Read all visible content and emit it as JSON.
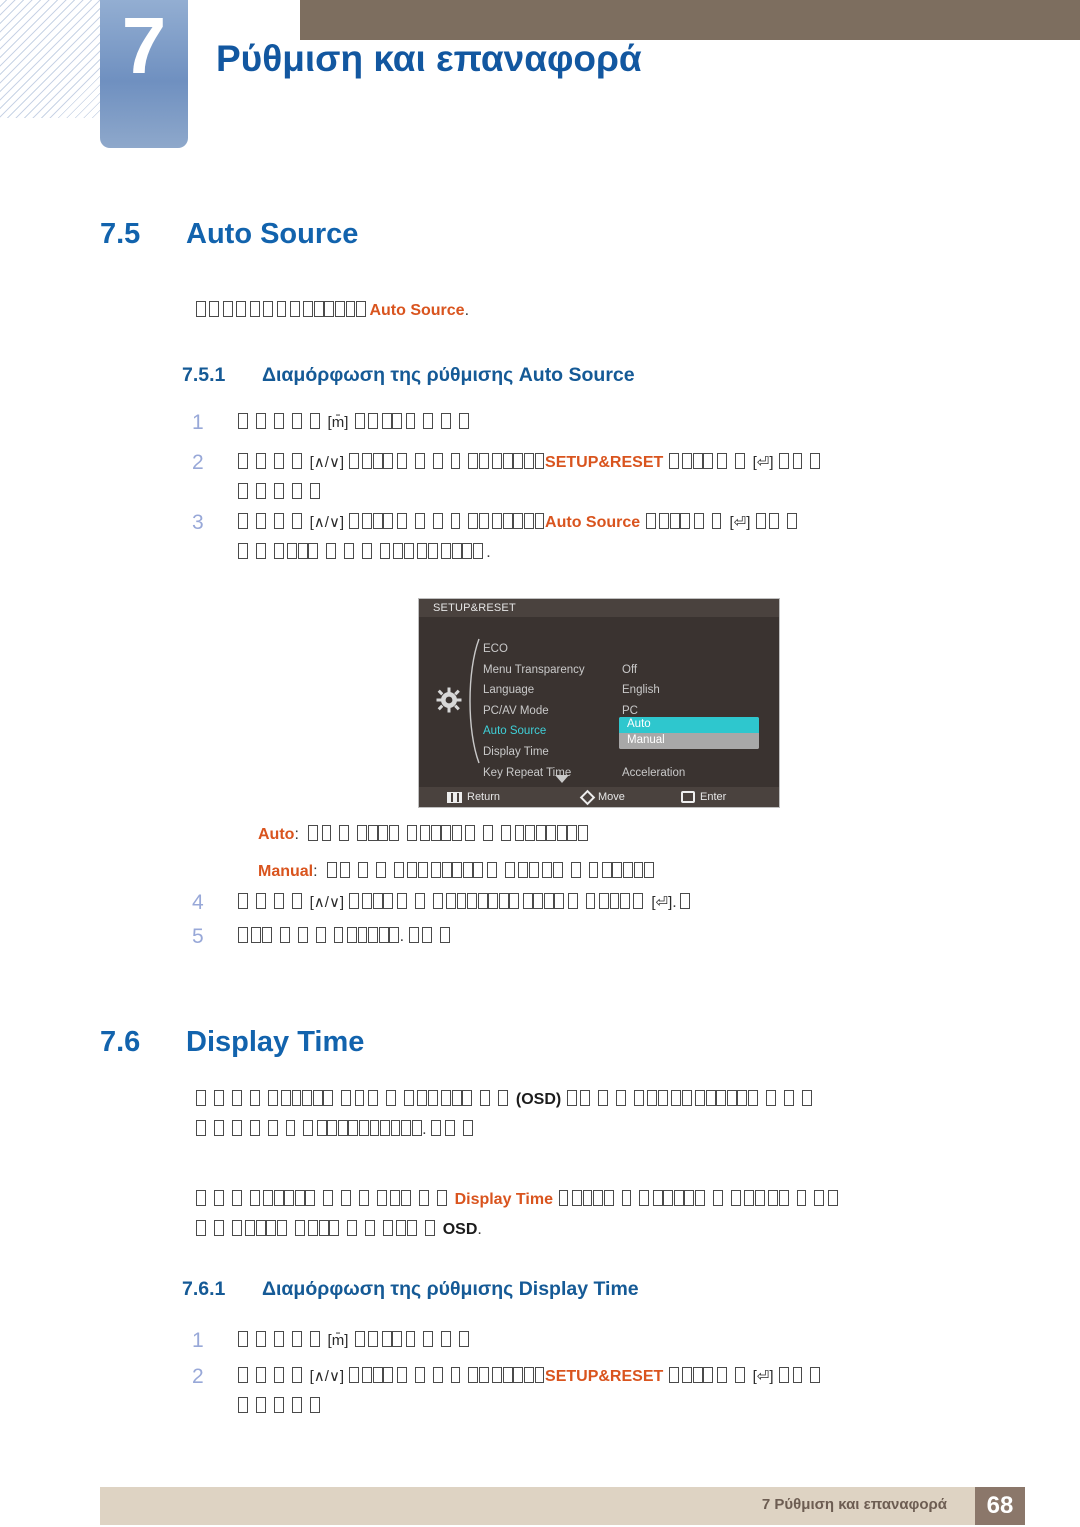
{
  "header": {
    "chapter_number": "7",
    "chapter_title": "Ρύθμιση και επαναφορά"
  },
  "sections": [
    {
      "number": "7.5",
      "title": "Auto Source",
      "intro_prefix_boxes": 9,
      "intro_mid_boxes": 5,
      "intro_term": "Auto Source",
      "intro_suffix": "."
    },
    {
      "number": "7.6",
      "title": "Display Time"
    }
  ],
  "subsections": [
    {
      "number": "7.5.1",
      "title": "Διαμόρφωση της ρύθμισης Auto Source"
    },
    {
      "number": "7.6.1",
      "title": "Διαμόρφωση της ρύθμισης Display Time"
    }
  ],
  "steps_751": [
    {
      "marker": "1",
      "key": "[m̄]"
    },
    {
      "marker": "2",
      "key": "[∧/∨]",
      "term": "SETUP&RESET",
      "key2": "[⏎]"
    },
    {
      "marker": "3",
      "key": "[∧/∨]",
      "term": "Auto Source",
      "key2": "[⏎]"
    },
    {
      "marker": "4",
      "key": "[∧/∨]",
      "key2": "[⏎]"
    },
    {
      "marker": "5"
    }
  ],
  "steps_761": [
    {
      "marker": "1",
      "key": "[m̄]"
    },
    {
      "marker": "2",
      "key": "[∧/∨]",
      "term": "SETUP&RESET",
      "key2": "[⏎]"
    }
  ],
  "options": [
    {
      "label": "Auto",
      "color": "#d9541e"
    },
    {
      "label": "Manual",
      "color": "#d9541e"
    }
  ],
  "display_time_paras": {
    "p1_term": "(OSD)",
    "p2_term": "Display Time",
    "p2_term2": "OSD"
  },
  "osd": {
    "title": "SETUP&RESET",
    "menu_items": [
      {
        "label": "ECO",
        "value": "",
        "selected": false
      },
      {
        "label": "Menu Transparency",
        "value": "Off",
        "selected": false
      },
      {
        "label": "Language",
        "value": "English",
        "selected": false
      },
      {
        "label": "PC/AV Mode",
        "value": "PC",
        "selected": false
      },
      {
        "label": "Auto Source",
        "value": "",
        "selected": true
      },
      {
        "label": "Display Time",
        "value": "",
        "selected": false
      },
      {
        "label": "Key Repeat Time",
        "value": "Acceleration",
        "selected": false
      }
    ],
    "popup": {
      "highlighted": "Auto",
      "other": "Manual"
    },
    "footer": [
      {
        "icon": "return-icon",
        "label": "Return"
      },
      {
        "icon": "move-icon",
        "label": "Move"
      },
      {
        "icon": "enter-icon",
        "label": "Enter"
      }
    ]
  },
  "footer": {
    "text": "7 Ρύθμιση και επαναφορά",
    "page": "68"
  },
  "colors": {
    "heading_blue": "#1263ad",
    "accent_orange": "#d9541e",
    "osd_cyan": "#3fd0d8",
    "brown": "#7d6e5f",
    "footer_tan": "#ded3c3"
  }
}
